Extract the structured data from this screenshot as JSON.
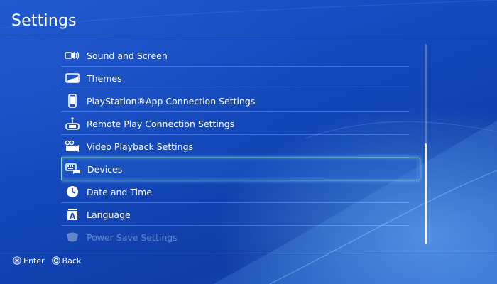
{
  "header": {
    "title": "Settings"
  },
  "menu": {
    "items": [
      {
        "label": "Sound and Screen",
        "icon": "speaker-screen-icon"
      },
      {
        "label": "Themes",
        "icon": "themes-icon"
      },
      {
        "label": "PlayStation®App Connection Settings",
        "icon": "smartphone-icon"
      },
      {
        "label": "Remote Play Connection Settings",
        "icon": "remote-play-icon"
      },
      {
        "label": "Video Playback Settings",
        "icon": "video-playback-icon"
      },
      {
        "label": "Devices",
        "icon": "devices-icon",
        "selected": true
      },
      {
        "label": "Date and Time",
        "icon": "clock-icon"
      },
      {
        "label": "Language",
        "icon": "language-icon"
      },
      {
        "label": "Power Save Settings",
        "icon": "power-save-icon"
      }
    ]
  },
  "footer": {
    "enter_label": "Enter",
    "back_label": "Back"
  },
  "colors": {
    "background": "#1347b8",
    "highlight": "#8fd8ff",
    "text": "#ffffff"
  }
}
